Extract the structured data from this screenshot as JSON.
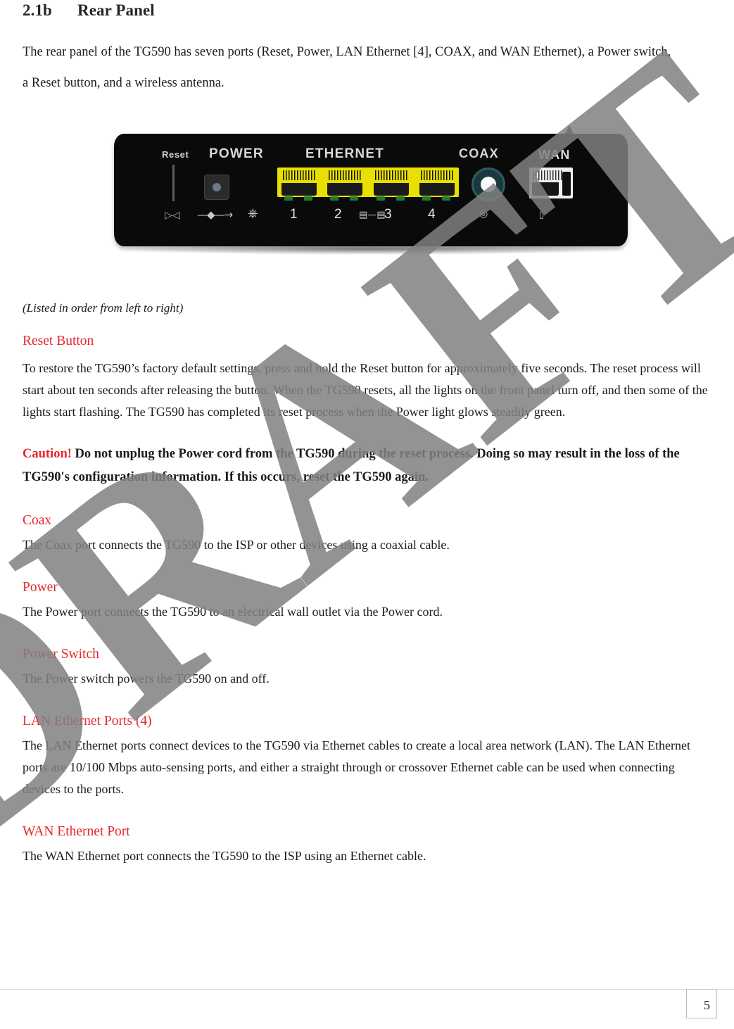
{
  "document": {
    "heading": {
      "number": "2.1b",
      "title": "Rear Panel"
    },
    "intro": "The rear panel of the TG590 has seven ports (Reset, Power, LAN Ethernet [4], COAX, and WAN Ethernet), a Power switch, a Reset button, and a wireless antenna.",
    "figure": {
      "alt_name": "tg590-rear-panel-photo",
      "labels": {
        "reset": "Reset",
        "power": "POWER",
        "ethernet": "ETHERNET",
        "coax": "COAX",
        "wan": "WAN"
      },
      "port_numbers": [
        "1",
        "2",
        "3",
        "4"
      ],
      "icons": {
        "reset_icon": "reset-arrow-icon",
        "power_arrow_icon": "power-plug-icon",
        "power_symbol_icon": "power-switch-icon",
        "ethernet_icon": "network-icon",
        "coax_icon": "coax-connector-icon",
        "wan_icon": "wan-port-icon",
        "antenna_icon": "antenna-icon"
      }
    },
    "caption": "(Listed in order from left to right)",
    "sections": [
      {
        "heading": "Reset Button",
        "body": "To restore the TG590’s factory default settings, press and hold the Reset button for approximately five seconds. The reset process will start about ten seconds after releasing the button. When the TG590 resets, all the lights on the front panel turn off, and then some of the lights start flashing. The TG590 has completed its reset process when the Power light glows steadily green."
      },
      {
        "heading": "Coax",
        "body": "The Coax port connects the TG590 to the ISP or other devices using a coaxial cable."
      },
      {
        "heading": "Power",
        "body": "The Power port connects the TG590 to an electrical wall outlet via the Power cord."
      },
      {
        "heading": "Power Switch",
        "body": "The Power switch powers the TG590 on and off."
      },
      {
        "heading": "LAN Ethernet Ports (4)",
        "body": "The LAN Ethernet ports connect devices to the TG590 via Ethernet cables to create a local area network (LAN). The LAN Ethernet ports are 10/100 Mbps auto-sensing ports, and either a straight through or crossover Ethernet cable can be used when connecting devices to the ports."
      },
      {
        "heading": "WAN Ethernet Port",
        "body": "The WAN Ethernet port connects the TG590 to the ISP using an Ethernet cable."
      }
    ],
    "caution": {
      "word": "Caution!",
      "text": "Do not unplug the Power cord from the TG590 during the reset process. Doing so may result in the loss of the TG590's configuration information. If this occurs, reset the TG590 again."
    },
    "watermark": "DRAFT",
    "page_number": "5",
    "colors": {
      "accent_red": "#e8262c",
      "body_text": "#1b1b1b",
      "watermark_gray": "#808080",
      "ethernet_yellow": "#e8e000"
    }
  }
}
